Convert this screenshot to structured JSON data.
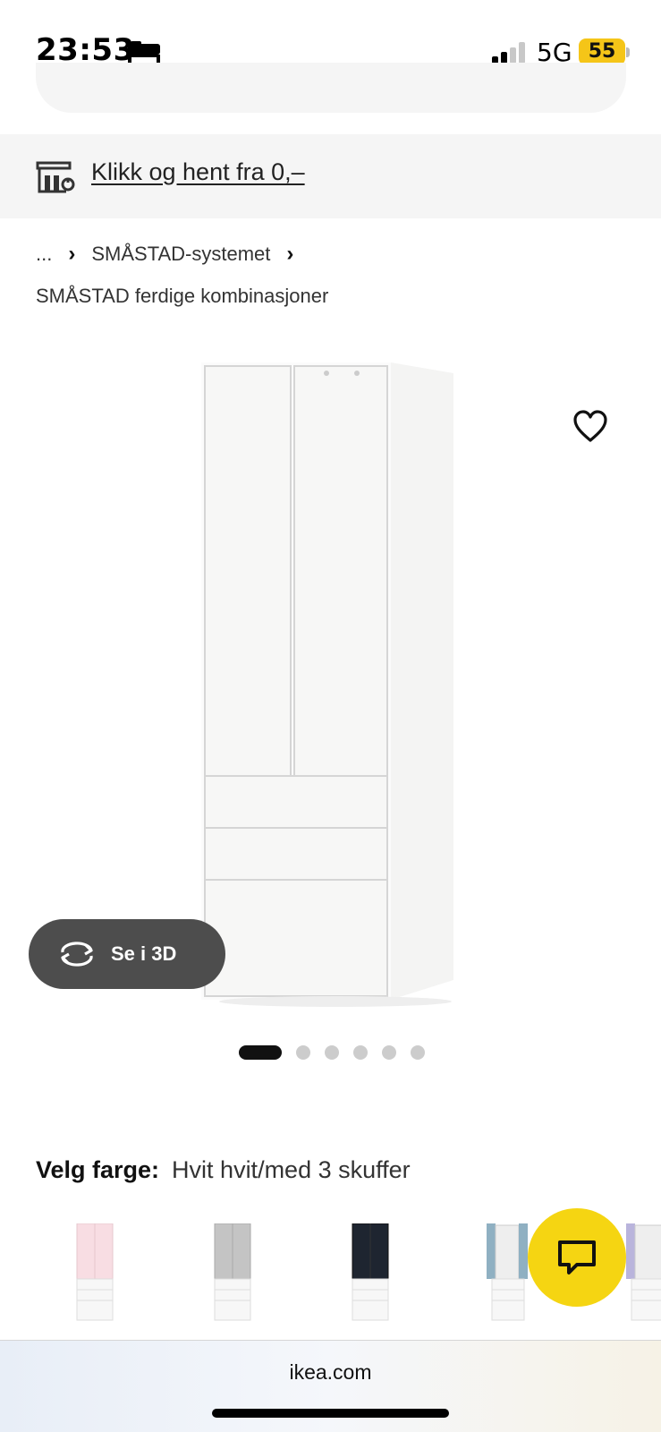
{
  "status_bar": {
    "time": "23:53",
    "network": "5G",
    "battery": "55"
  },
  "banner": {
    "pickup_text": "Klikk og hent fra 0,–"
  },
  "breadcrumb": {
    "ellipsis": "...",
    "system": "SMÅSTAD-systemet",
    "sub": "SMÅSTAD ferdige kombinasjoner"
  },
  "product": {
    "view3d_label": "Se i 3D",
    "image_count": 6,
    "active_image": 1
  },
  "color_select": {
    "label": "Velg farge:",
    "value": "Hvit hvit/med 3 skuffer"
  },
  "swatches": [
    {
      "name": "pink",
      "color": "#f8dde3"
    },
    {
      "name": "grey",
      "color": "#c4c4c4"
    },
    {
      "name": "dark",
      "color": "#1e2530"
    },
    {
      "name": "blue",
      "color": "#8fb0c2"
    },
    {
      "name": "lilac",
      "color": "#b9b4dc"
    }
  ],
  "browser": {
    "url": "ikea.com"
  }
}
